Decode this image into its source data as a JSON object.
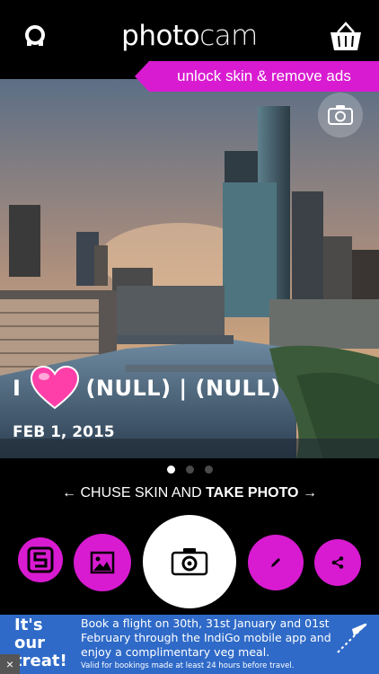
{
  "header": {
    "title_part1": "photo",
    "title_part2": "cam",
    "unlock_label": "unlock skin & remove ads"
  },
  "overlay": {
    "prefix": "I",
    "text": "(NULL) | (NULL)",
    "date": "FEB 1, 2015"
  },
  "pager": {
    "count": 3,
    "active": 1
  },
  "hint": {
    "pre": "← CHUSE SKIN AND ",
    "bold": "TAKE PHOTO",
    "post": " →"
  },
  "ad": {
    "logo_line1": "It's",
    "logo_line2": "our",
    "logo_line3": "treat!",
    "text": "Book a flight on 30th, 31st January and 01st February through the IndiGo mobile app and enjoy a complimentary veg meal.",
    "footnote": "Valid for bookings made at least 24 hours before travel.",
    "close_label": "×"
  },
  "colors": {
    "accent": "#d81bd1",
    "background": "#000000",
    "ad_blue": "#2f6ac8"
  },
  "icons": {
    "header_left": "refresh-icon",
    "header_right": "basket-icon",
    "switch": "switch-camera-icon",
    "skin": "skin-s-icon",
    "gallery": "image-gallery-icon",
    "shutter": "camera-icon",
    "edit": "pencil-icon",
    "share": "share-icon",
    "heart": "heart-icon"
  }
}
